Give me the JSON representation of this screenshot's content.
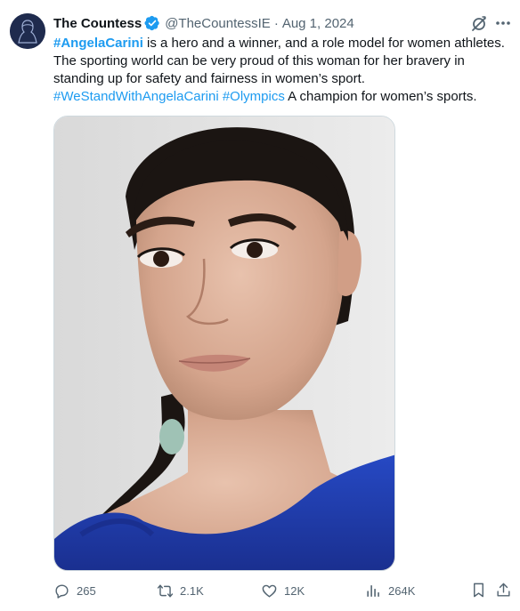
{
  "author": {
    "name": "The Countess",
    "handle": "@TheCountessIE",
    "separator": "·",
    "date": "Aug 1, 2024"
  },
  "tweet": {
    "lines": [
      [
        {
          "t": "#AngelaCarini",
          "k": "tag-bold"
        },
        {
          "t": " is a hero and a winner, and a role model for women athletes.",
          "k": "text"
        }
      ],
      [
        {
          "t": "The sporting world can be very proud of this woman for her bravery in",
          "k": "text"
        }
      ],
      [
        {
          "t": "standing up for safety and fairness in women’s sport.",
          "k": "text"
        }
      ],
      [
        {
          "t": "#WeStandWithAngelaCarini",
          "k": "tag"
        },
        {
          "t": " ",
          "k": "text"
        },
        {
          "t": "#Olympics",
          "k": "tag"
        },
        {
          "t": " A champion for women’s sports.",
          "k": "text"
        }
      ]
    ]
  },
  "actions": {
    "replies": "265",
    "reposts": "2.1K",
    "likes": "12K",
    "views": "264K"
  },
  "icons": {
    "verified": "verified-badge-icon",
    "grok": "grok-icon",
    "more": "more-icon",
    "reply": "reply-icon",
    "repost": "repost-icon",
    "like": "like-icon",
    "views": "views-icon",
    "bookmark": "bookmark-icon",
    "share": "share-icon"
  },
  "colors": {
    "accent": "#1d9bf0",
    "secondary_text": "#536471",
    "primary_text": "#0f1419"
  }
}
